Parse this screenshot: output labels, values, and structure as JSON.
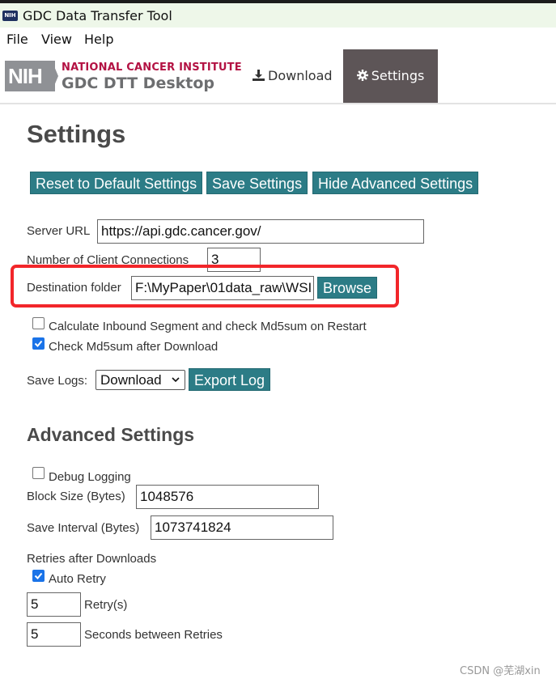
{
  "window": {
    "title": "GDC Data Transfer Tool",
    "icon_text": "NIH"
  },
  "menu": [
    "File",
    "View",
    "Help"
  ],
  "header": {
    "nih": "NIH",
    "institute": "NATIONAL CANCER INSTITUTE",
    "product": "GDC DTT Desktop",
    "nav": {
      "download": "Download",
      "settings": "Settings"
    }
  },
  "page": {
    "title": "Settings",
    "buttons": {
      "reset": "Reset to Default Settings",
      "save": "Save Settings",
      "hide_advanced": "Hide Advanced Settings"
    }
  },
  "form": {
    "server_url_label": "Server URL",
    "server_url_value": "https://api.gdc.cancer.gov/",
    "connections_label": "Number of Client Connections",
    "connections_value": "3",
    "destination_label": "Destination folder",
    "destination_value": "F:\\MyPaper\\01data_raw\\WSI",
    "browse": "Browse",
    "calc_inbound_label": "Calculate Inbound Segment and check Md5sum on Restart",
    "calc_inbound_checked": false,
    "check_md5_label": "Check Md5sum after Download",
    "check_md5_checked": true,
    "save_logs_label": "Save Logs:",
    "save_logs_value": "Download",
    "export_log": "Export Log"
  },
  "advanced": {
    "title": "Advanced Settings",
    "debug_label": "Debug Logging",
    "debug_checked": false,
    "block_size_label": "Block Size (Bytes)",
    "block_size_value": "1048576",
    "save_interval_label": "Save Interval (Bytes)",
    "save_interval_value": "1073741824",
    "retries_label": "Retries after Downloads",
    "auto_retry_label": "Auto Retry",
    "auto_retry_checked": true,
    "retry_count_value": "5",
    "retry_count_label": "Retry(s)",
    "retry_seconds_value": "5",
    "retry_seconds_label": "Seconds between Retries"
  },
  "watermark": "CSDN @芜湖xin",
  "colors": {
    "button": "#2c7c86",
    "nav_active": "#5d5557",
    "highlight": "#f2262a",
    "nci": "#b31243"
  }
}
